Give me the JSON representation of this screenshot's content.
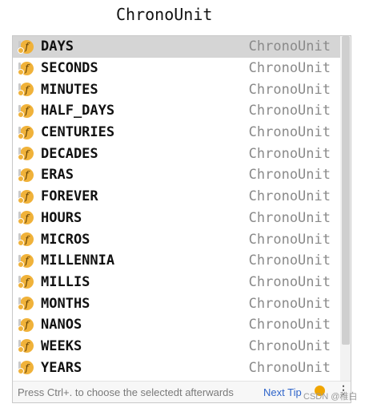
{
  "editor": {
    "text": "ChronoUnit"
  },
  "completion": {
    "items": [
      {
        "name": "DAYS",
        "type": "ChronoUnit",
        "selected": true
      },
      {
        "name": "SECONDS",
        "type": "ChronoUnit"
      },
      {
        "name": "MINUTES",
        "type": "ChronoUnit"
      },
      {
        "name": "HALF_DAYS",
        "type": "ChronoUnit"
      },
      {
        "name": "CENTURIES",
        "type": "ChronoUnit"
      },
      {
        "name": "DECADES",
        "type": "ChronoUnit"
      },
      {
        "name": "ERAS",
        "type": "ChronoUnit"
      },
      {
        "name": "FOREVER",
        "type": "ChronoUnit"
      },
      {
        "name": "HOURS",
        "type": "ChronoUnit"
      },
      {
        "name": "MICROS",
        "type": "ChronoUnit"
      },
      {
        "name": "MILLENNIA",
        "type": "ChronoUnit"
      },
      {
        "name": "MILLIS",
        "type": "ChronoUnit"
      },
      {
        "name": "MONTHS",
        "type": "ChronoUnit"
      },
      {
        "name": "NANOS",
        "type": "ChronoUnit"
      },
      {
        "name": "WEEKS",
        "type": "ChronoUnit"
      },
      {
        "name": "YEARS",
        "type": "ChronoUnit"
      }
    ],
    "icon": {
      "name": "field-icon",
      "glyph": "f",
      "color": "#f0b23a"
    },
    "footer": {
      "hint": "Press Ctrl+. to choose the selected",
      "hint_suffix": "t afterwards",
      "tip_link": "Next Tip",
      "tip_icon": "lightbulb-icon",
      "more": "⋮"
    }
  },
  "watermark": "CSDN @稚白"
}
